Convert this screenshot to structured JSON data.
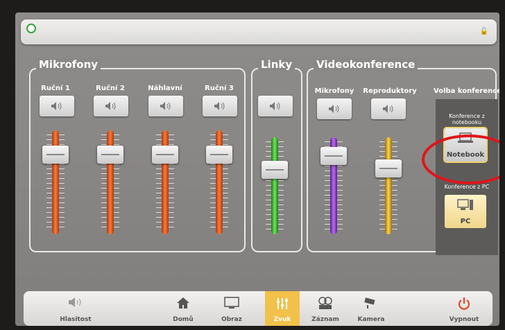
{
  "groups": {
    "mikrofony": "Mikrofony",
    "linky": "Linky",
    "videokonference": "Videokonference"
  },
  "channels": {
    "rucni1": "Ruční 1",
    "rucni2": "Ruční 2",
    "nahlavni": "Náhlavní",
    "rucni3": "Ruční 3",
    "vc_mikrofony": "Mikrofony",
    "vc_reproduktory": "Reproduktory",
    "volba": "Volba konference"
  },
  "conference": {
    "notebook_header": "Konference z notebooku",
    "notebook_label": "Notebook",
    "pc_header": "Konference z PC",
    "pc_label": "PC"
  },
  "nav": {
    "hlasitost": "Hlasitost",
    "domu": "Domů",
    "obraz": "Obraz",
    "zvuk": "Zvuk",
    "zaznam": "Záznam",
    "kamera": "Kamera",
    "vypnout": "Vypnout"
  },
  "colors": {
    "orange": "#e0601e",
    "green": "#3cb832",
    "purple": "#9a3ad0",
    "yellow": "#e6b020",
    "accent": "#f2c14a",
    "highlight": "#e1141b"
  }
}
